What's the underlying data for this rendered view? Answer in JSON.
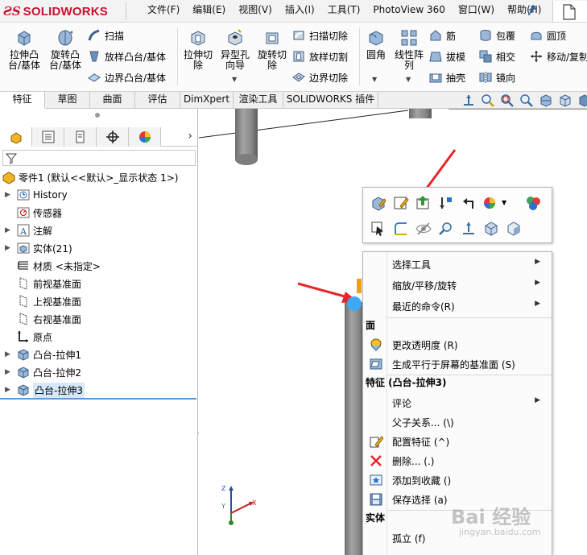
{
  "app": {
    "logo_text": "SOLIDWORKS",
    "menus": [
      "文件(F)",
      "编辑(E)",
      "视图(V)",
      "插入(I)",
      "工具(T)",
      "PhotoView 360",
      "窗口(W)",
      "帮助(H)"
    ]
  },
  "ribbon": {
    "extrude_boss": "拉伸凸\n台/基体",
    "revolve_boss": "旋转凸\n台/基体",
    "sweep": "扫描",
    "loft_boss": "放样凸台/基体",
    "boundary_boss": "边界凸台/基体",
    "extrude_cut": "拉伸切\n除",
    "hole_wizard": "异型孔\n向导",
    "revolve_cut": "旋转切\n除",
    "sweep_cut": "扫描切除",
    "loft_cut": "放样切割",
    "boundary_cut": "边界切除",
    "fillet": "圆角",
    "linear_pattern": "线性阵\n列",
    "rib": "筋",
    "draft": "拔模",
    "shell": "抽壳",
    "wrap": "包覆",
    "intersect": "相交",
    "mirror": "镜向",
    "dome": "圆顶",
    "move_copy": "移动/复制"
  },
  "tabs": [
    "特征",
    "草图",
    "曲面",
    "评估",
    "DimXpert",
    "渲染工具",
    "SOLIDWORKS 插件"
  ],
  "active_tab": "特征",
  "tree": {
    "root": "零件1 (默认<<默认>_显示状态 1>)",
    "items": [
      {
        "label": "History",
        "icon": "history-icon",
        "expandable": true
      },
      {
        "label": "传感器",
        "icon": "sensor-icon",
        "expandable": false
      },
      {
        "label": "注解",
        "icon": "annotation-icon",
        "expandable": true
      },
      {
        "label": "实体(21)",
        "icon": "solid-bodies-icon",
        "expandable": true
      },
      {
        "label": "材质 <未指定>",
        "icon": "material-icon",
        "expandable": false
      },
      {
        "label": "前视基准面",
        "icon": "plane-icon",
        "expandable": false
      },
      {
        "label": "上视基准面",
        "icon": "plane-icon",
        "expandable": false
      },
      {
        "label": "右视基准面",
        "icon": "plane-icon",
        "expandable": false
      },
      {
        "label": "原点",
        "icon": "origin-icon",
        "expandable": false
      },
      {
        "label": "凸台-拉伸1",
        "icon": "extrude-icon",
        "expandable": true
      },
      {
        "label": "凸台-拉伸2",
        "icon": "extrude-icon",
        "expandable": true
      },
      {
        "label": "凸台-拉伸3",
        "icon": "extrude-icon",
        "expandable": true,
        "selected": true
      }
    ]
  },
  "context_menu": {
    "items_top": [
      {
        "label": "选择工具",
        "submenu": true
      },
      {
        "label": "缩放/平移/旋转",
        "submenu": true
      },
      {
        "label": "最近的命令(R)",
        "submenu": true
      }
    ],
    "header_face": "面",
    "face_items": [
      {
        "label": "更改透明度 (R)",
        "icon": "transparency-icon"
      },
      {
        "label": "生成平行于屏幕的基准面 (S)",
        "icon": "plane-screen-icon"
      }
    ],
    "header_feature": "特征 (凸台-拉伸3)",
    "feature_items": [
      {
        "label": "评论",
        "submenu": true,
        "icon": ""
      },
      {
        "label": "父子关系... (\\)",
        "icon": ""
      },
      {
        "label": "配置特征 (^)",
        "icon": "configure-icon"
      },
      {
        "label": "删除... (.)",
        "icon": "delete-icon"
      },
      {
        "label": "添加到收藏 ()",
        "icon": "favorite-icon"
      },
      {
        "label": "保存选择 (a)",
        "icon": "save-selection-icon"
      }
    ],
    "header_body": "实体",
    "body_items": [
      {
        "label": "孤立 (f)",
        "icon": ""
      }
    ]
  },
  "colors": {
    "brand": "#c8102e",
    "annotation_arrow": "#e8262a",
    "selection": "#5b9bd5"
  },
  "watermark": {
    "main": "Bai 经验",
    "sub": "jingyan.baidu.com"
  }
}
